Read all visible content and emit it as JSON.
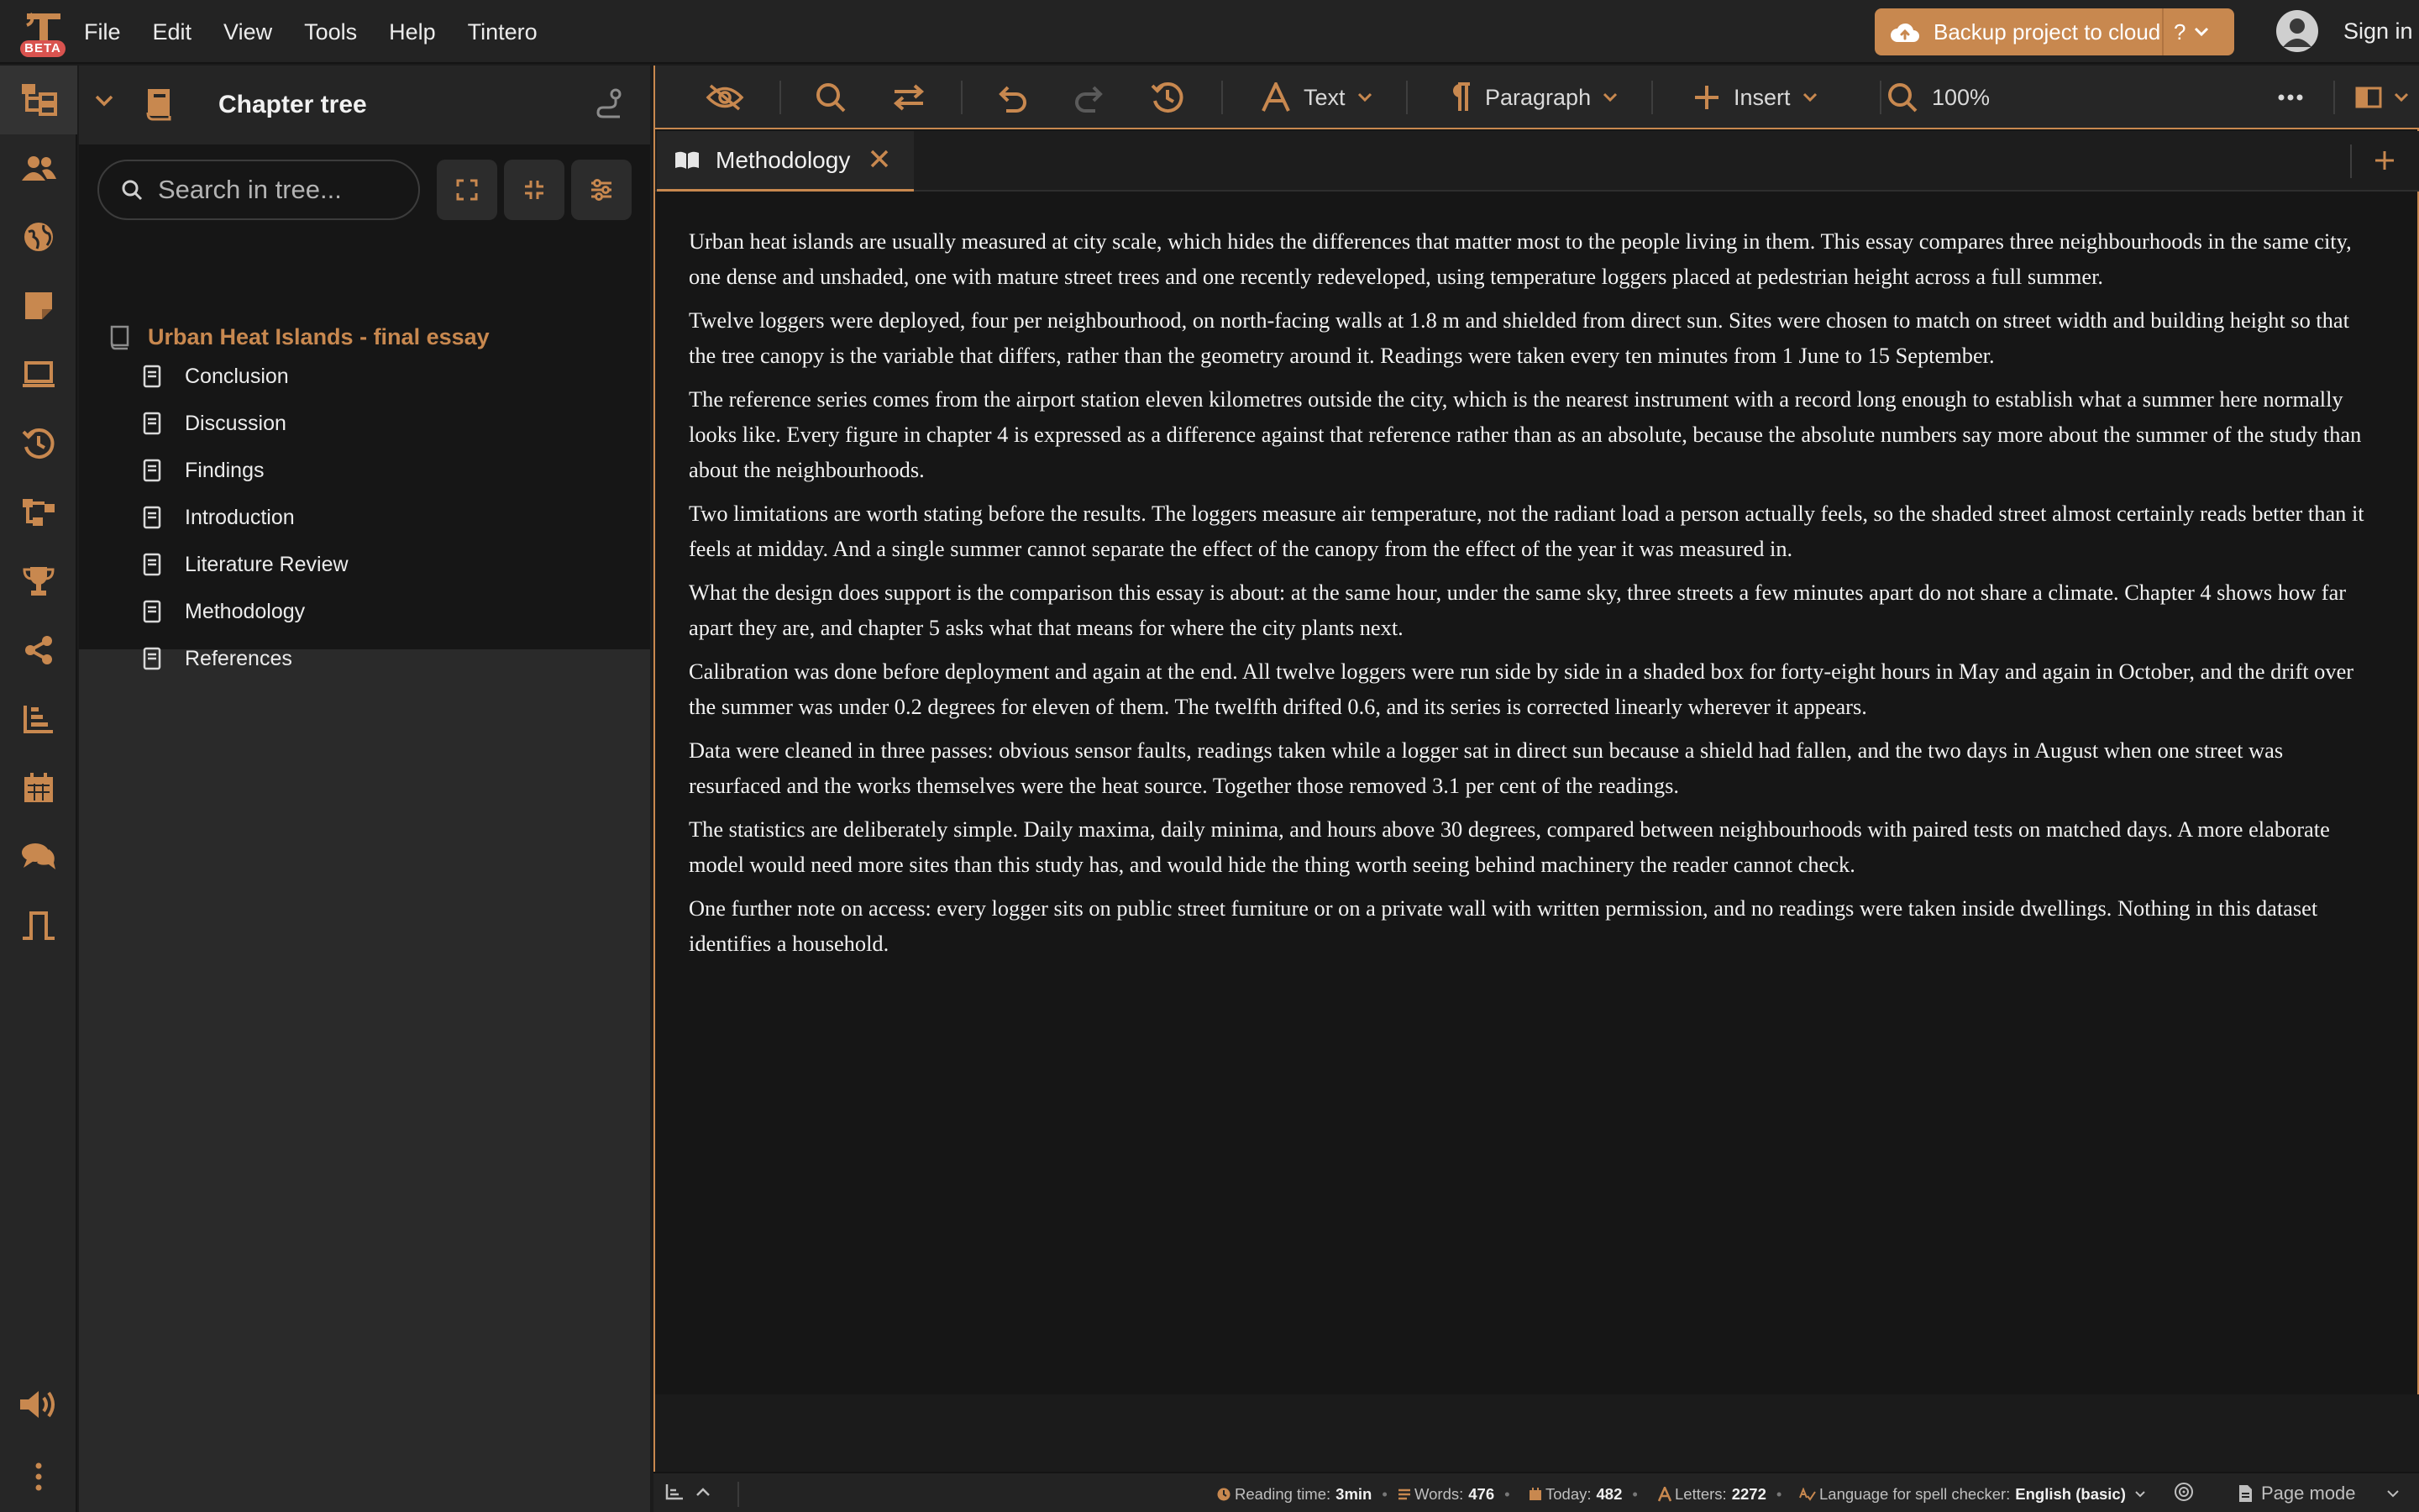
{
  "menubar": {
    "beta_badge": "BETA",
    "menus": [
      "File",
      "Edit",
      "View",
      "Tools",
      "Help",
      "Tintero"
    ],
    "backup_label": "Backup project to cloud",
    "help_label": "?",
    "signin_label": "Sign in"
  },
  "rail": {
    "icons": [
      "chapter-tree-icon",
      "characters-icon",
      "world-icon",
      "notes-icon",
      "laptop-icon",
      "history-icon",
      "flow-icon",
      "trophy-icon",
      "share-icon",
      "stats-icon",
      "calendar-icon",
      "chat-icon",
      "timeline-icon",
      "sound-icon",
      "more-vertical-icon"
    ]
  },
  "tree": {
    "title": "Chapter tree",
    "search_placeholder": "Search in tree...",
    "project_name": "Urban Heat Islands - final essay",
    "items": [
      "Conclusion",
      "Discussion",
      "Findings",
      "Introduction",
      "Literature Review",
      "Methodology",
      "References"
    ]
  },
  "toolbar": {
    "text_label": "Text",
    "paragraph_label": "Paragraph",
    "insert_label": "Insert",
    "zoom_label": "100%"
  },
  "tabs": {
    "active_label": "Methodology"
  },
  "document": {
    "paragraphs": [
      "Urban heat islands are usually measured at city scale, which hides the differences that matter most to the people living in them. This essay compares three neighbourhoods in the same city, one dense and unshaded, one with mature street trees and one recently redeveloped, using temperature loggers placed at pedestrian height across a full summer.",
      "Twelve loggers were deployed, four per neighbourhood, on north-facing walls at 1.8 m and shielded from direct sun. Sites were chosen to match on street width and building height so that the tree canopy is the variable that differs, rather than the geometry around it. Readings were taken every ten minutes from 1 June to 15 September.",
      "The reference series comes from the airport station eleven kilometres outside the city, which is the nearest instrument with a record long enough to establish what a summer here normally looks like. Every figure in chapter 4 is expressed as a difference against that reference rather than as an absolute, because the absolute numbers say more about the summer of the study than about the neighbourhoods.",
      "Two limitations are worth stating before the results. The loggers measure air temperature, not the radiant load a person actually feels, so the shaded street almost certainly reads better than it feels at midday. And a single summer cannot separate the effect of the canopy from the effect of the year it was measured in.",
      "What the design does support is the comparison this essay is about: at the same hour, under the same sky, three streets a few minutes apart do not share a climate. Chapter 4 shows how far apart they are, and chapter 5 asks what that means for where the city plants next.",
      "Calibration was done before deployment and again at the end. All twelve loggers were run side by side in a shaded box for forty-eight hours in May and again in October, and the drift over the summer was under 0.2 degrees for eleven of them. The twelfth drifted 0.6, and its series is corrected linearly wherever it appears.",
      "Data were cleaned in three passes: obvious sensor faults, readings taken while a logger sat in direct sun because a shield had fallen, and the two days in August when one street was resurfaced and the works themselves were the heat source. Together those removed 3.1 per cent of the readings.",
      "The statistics are deliberately simple. Daily maxima, daily minima, and hours above 30 degrees, compared between neighbourhoods with paired tests on matched days. A more elaborate model would need more sites than this study has, and would hide the thing worth seeing behind machinery the reader cannot check.",
      "One further note on access: every logger sits on public street furniture or on a private wall with written permission, and no readings were taken inside dwellings. Nothing in this dataset identifies a household."
    ]
  },
  "status": {
    "reading_label": "Reading time:",
    "reading_value": "3min",
    "words_label": "Words:",
    "words_value": "476",
    "today_label": "Today:",
    "today_value": "482",
    "letters_label": "Letters:",
    "letters_value": "2272",
    "lang_label": "Language for spell checker:",
    "lang_value": "English (basic)",
    "mode_label": "Page mode"
  },
  "colors": {
    "accent": "#c8884f",
    "background": "#161616",
    "panel": "#262626"
  }
}
